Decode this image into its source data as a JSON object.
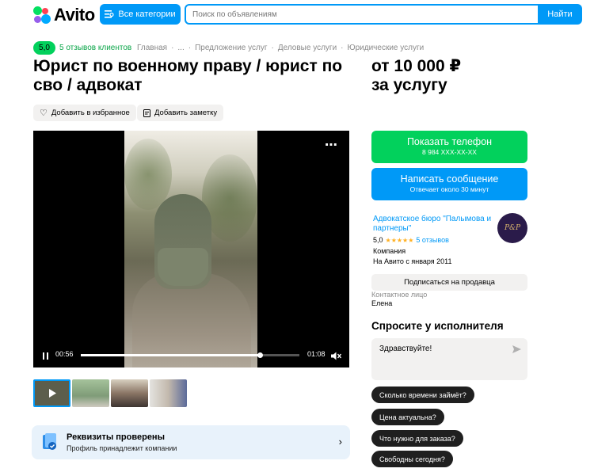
{
  "header": {
    "logo_text": "Avito",
    "categories_label": "Все категории",
    "search_placeholder": "Поиск по объявлениям",
    "search_button": "Найти",
    "brand_colors": [
      "#04e061",
      "#ff4053",
      "#965eeb",
      "#0af"
    ]
  },
  "listing": {
    "rating": "5,0",
    "reviews_link": "5 отзывов клиентов",
    "breadcrumbs": [
      "Главная",
      "·",
      "...",
      "·",
      "Предложение услуг",
      "·",
      "Деловые услуги",
      "·",
      "Юридические услуги"
    ],
    "title": "Юрист по военному праву / юрист по сво / адвокат",
    "price": "от 10 000 ₽",
    "price_unit": "за услугу",
    "favorite_label": "Добавить в избранное",
    "note_label": "Добавить заметку"
  },
  "video": {
    "current_time": "00:56",
    "duration": "01:08",
    "progress": 0.82
  },
  "verified": {
    "title": "Реквизиты проверены",
    "subtitle": "Профиль принадлежит компании"
  },
  "contact": {
    "show_phone": "Показать телефон",
    "phone_masked": "8 984 XXX-XX-XX",
    "write_message": "Написать сообщение",
    "response_time": "Отвечает около 30 минут"
  },
  "seller": {
    "name": "Адвокатское бюро \"Палымова и партнеры\"",
    "logo_text": "P&P",
    "rating": "5,0",
    "stars": "★★★★★",
    "reviews": "5 отзывов",
    "type": "Компания",
    "since": "На Авито с января 2011",
    "subscribe": "Подписаться на продавца",
    "contact_label": "Контактное лицо",
    "contact_name": "Елена"
  },
  "ask": {
    "title": "Спросите у исполнителя",
    "message": "Здравствуйте!",
    "quick_questions": [
      "Сколько времени займёт?",
      "Цена актуальна?",
      "Что нужно для заказа?",
      "Свободны сегодня?"
    ]
  }
}
